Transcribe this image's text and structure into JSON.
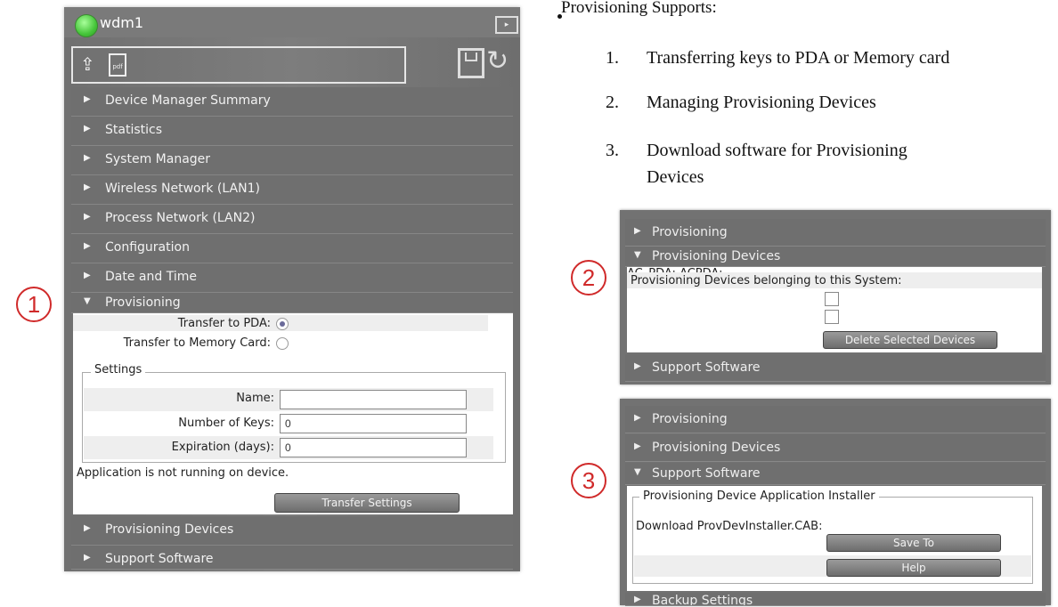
{
  "device_panel": {
    "title": "wdm1",
    "menu_items": [
      {
        "label": "Device Manager Summary",
        "arrow": "▶"
      },
      {
        "label": "Statistics",
        "arrow": "▶"
      },
      {
        "label": "System Manager",
        "arrow": "▶"
      },
      {
        "label": "Wireless Network (LAN1)",
        "arrow": "▶"
      },
      {
        "label": "Process Network (LAN2)",
        "arrow": "▶"
      },
      {
        "label": "Configuration",
        "arrow": "▶"
      },
      {
        "label": "Date and Time",
        "arrow": "▶"
      },
      {
        "label": "Provisioning",
        "arrow": "▼"
      }
    ],
    "provisioning": {
      "transfer_to_pda_label": "Transfer to PDA:",
      "transfer_to_memory_label": "Transfer to Memory Card:",
      "settings_legend": "Settings",
      "name_label": "Name:",
      "name_value": "",
      "keys_label": "Number of Keys:",
      "keys_value": "0",
      "expiration_label": "Expiration (days):",
      "expiration_value": "0",
      "status_text": "Application is not running on device.",
      "transfer_button": "Transfer Settings"
    },
    "bottom_items": [
      {
        "label": "Provisioning Devices",
        "arrow": "▶"
      },
      {
        "label": "Support Software",
        "arrow": "▶"
      }
    ]
  },
  "bullets": {
    "heading": "Provisioning Supports:",
    "items": [
      {
        "num": "1.",
        "text": "Transferring keys to PDA or Memory card"
      },
      {
        "num": "2.",
        "text": "Managing Provisioning Devices"
      },
      {
        "num": "3.",
        "text_line1": "Download software for Provisioning",
        "text_line2": "Devices"
      }
    ]
  },
  "callouts": {
    "one": "1",
    "two": "2",
    "three": "3"
  },
  "panel2": {
    "rows": [
      {
        "label": "Provisioning",
        "arrow": "▶"
      },
      {
        "label": "Provisioning Devices",
        "arrow": "▼"
      }
    ],
    "devices_heading": "Provisioning Devices belonging to this System:",
    "devices": [
      "AC_PDA:",
      "ACPDA:"
    ],
    "delete_button": "Delete Selected Devices",
    "footer_row": {
      "label": "Support Software",
      "arrow": "▶"
    }
  },
  "panel3": {
    "rows": [
      {
        "label": "Provisioning",
        "arrow": "▶"
      },
      {
        "label": "Provisioning Devices",
        "arrow": "▶"
      },
      {
        "label": "Support Software",
        "arrow": "▼"
      }
    ],
    "installer_legend": "Provisioning Device Application Installer",
    "download_label": "Download ProvDevInstaller.CAB:",
    "save_button": "Save To",
    "help_button": "Help",
    "footer_row": {
      "label": "Backup Settings",
      "arrow": "▶"
    }
  },
  "colors": {
    "panel_bg": "#757575",
    "status_green": "#46c53a",
    "callout_red": "#d02a2a"
  }
}
